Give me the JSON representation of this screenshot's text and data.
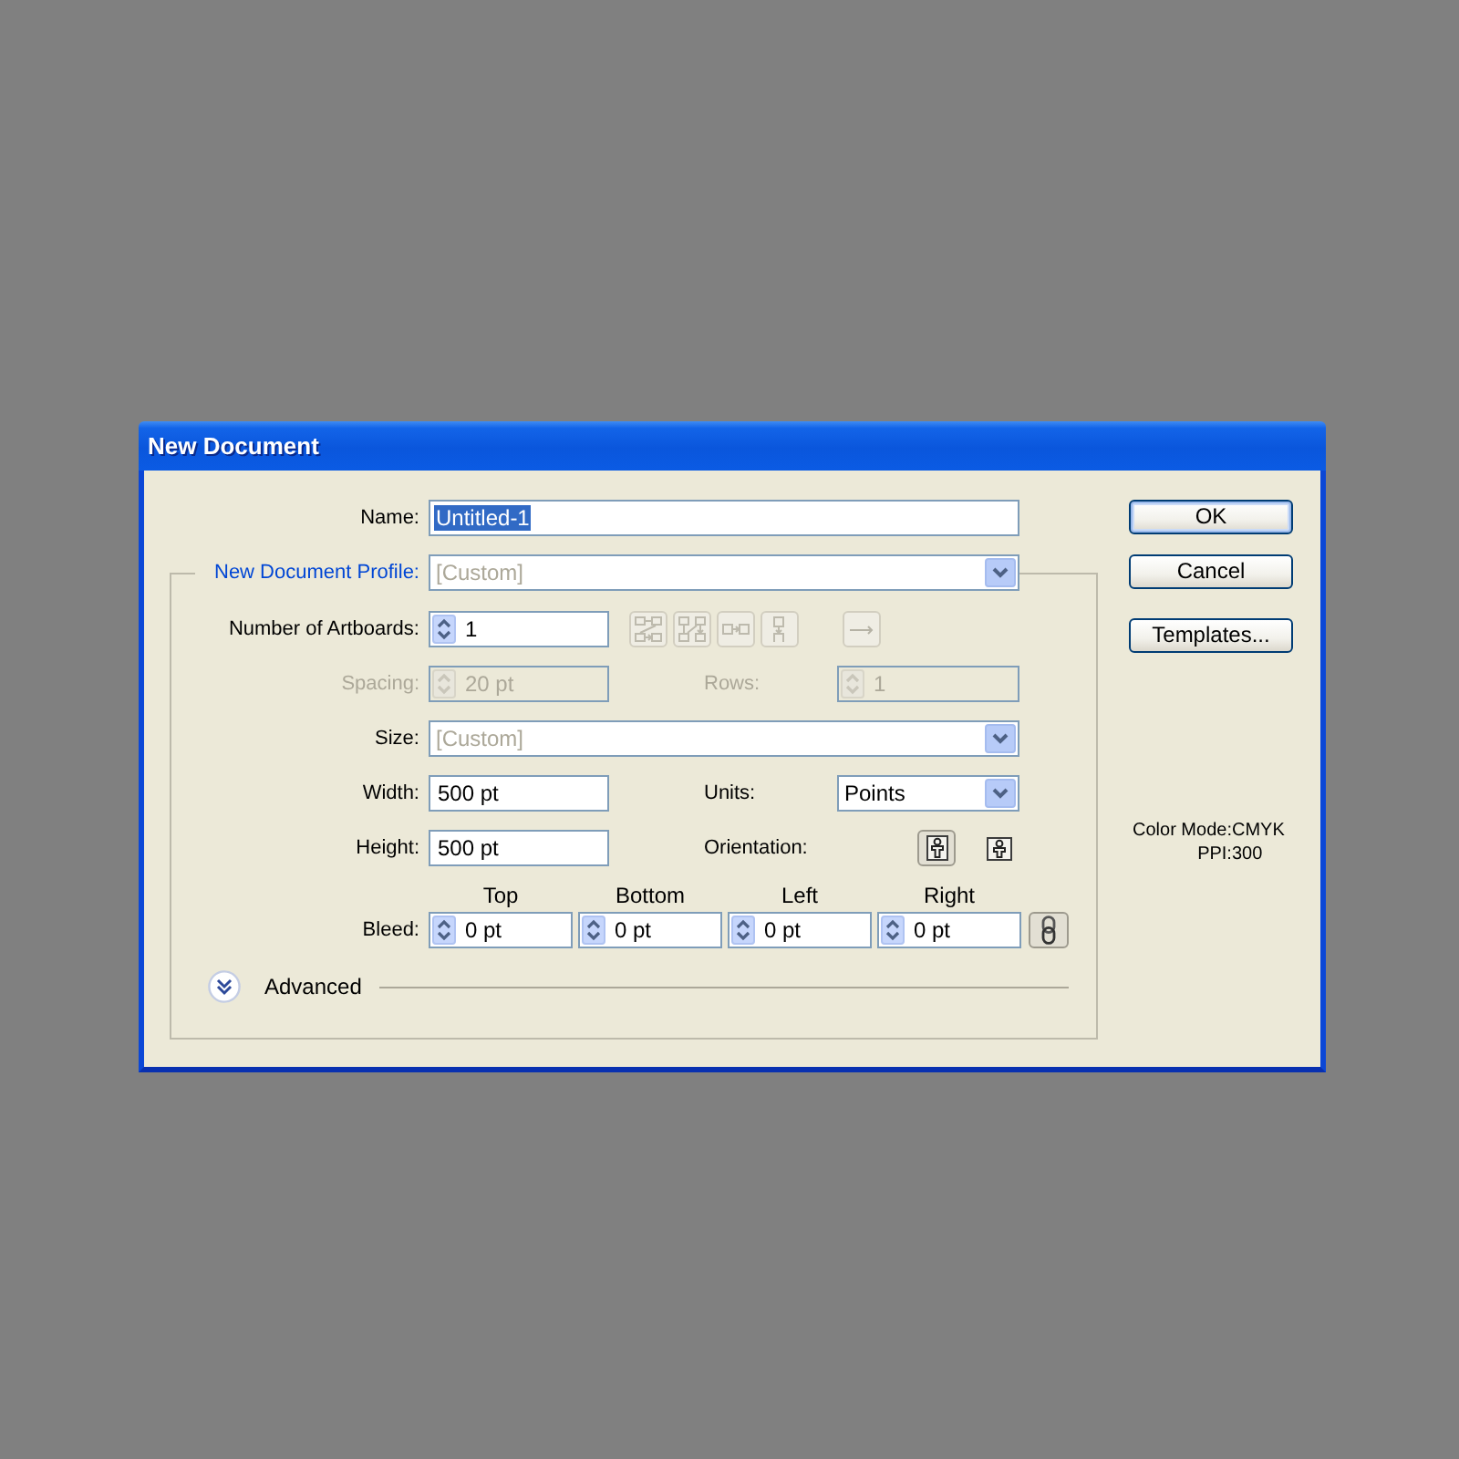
{
  "window": {
    "title": "New Document"
  },
  "name_field": {
    "label": "Name:",
    "value": "Untitled-1",
    "value_selected": true
  },
  "profile": {
    "label": "New Document Profile:",
    "value": "[Custom]",
    "dimmed": true
  },
  "artboards": {
    "label": "Number of Artboards:",
    "value": "1",
    "layout_buttons": [
      {
        "kind": "grid_by_row",
        "disabled": true
      },
      {
        "kind": "grid_by_column",
        "disabled": true
      },
      {
        "kind": "arrange_by_row",
        "disabled": true
      },
      {
        "kind": "arrange_by_column",
        "disabled": true
      }
    ],
    "direction_button": {
      "disabled": true
    }
  },
  "spacing": {
    "label": "Spacing:",
    "value": "20 pt",
    "disabled": true
  },
  "rows": {
    "label": "Rows:",
    "value": "1",
    "disabled": true
  },
  "size": {
    "label": "Size:",
    "value": "[Custom]",
    "dimmed": true
  },
  "width": {
    "label": "Width:",
    "value": "500 pt"
  },
  "units": {
    "label": "Units:",
    "value": "Points",
    "dimmed": false
  },
  "height": {
    "label": "Height:",
    "value": "500 pt"
  },
  "orientation": {
    "label": "Orientation:",
    "options": [
      {
        "kind": "portrait",
        "selected": true
      },
      {
        "kind": "landscape",
        "selected": false
      }
    ]
  },
  "bleed": {
    "label": "Bleed:",
    "sides": [
      {
        "label": "Top",
        "value": "0 pt"
      },
      {
        "label": "Bottom",
        "value": "0 pt"
      },
      {
        "label": "Left",
        "value": "0 pt"
      },
      {
        "label": "Right",
        "value": "0 pt"
      }
    ],
    "linked": true
  },
  "advanced": {
    "label": "Advanced",
    "expanded": false
  },
  "buttons": [
    {
      "label": "OK",
      "default": true
    },
    {
      "label": "Cancel",
      "default": false
    },
    {
      "label": "Templates...",
      "default": false
    }
  ],
  "info": [
    {
      "label": "Color Mode:",
      "value": "CMYK"
    },
    {
      "label": "PPI:",
      "value": "300"
    }
  ]
}
